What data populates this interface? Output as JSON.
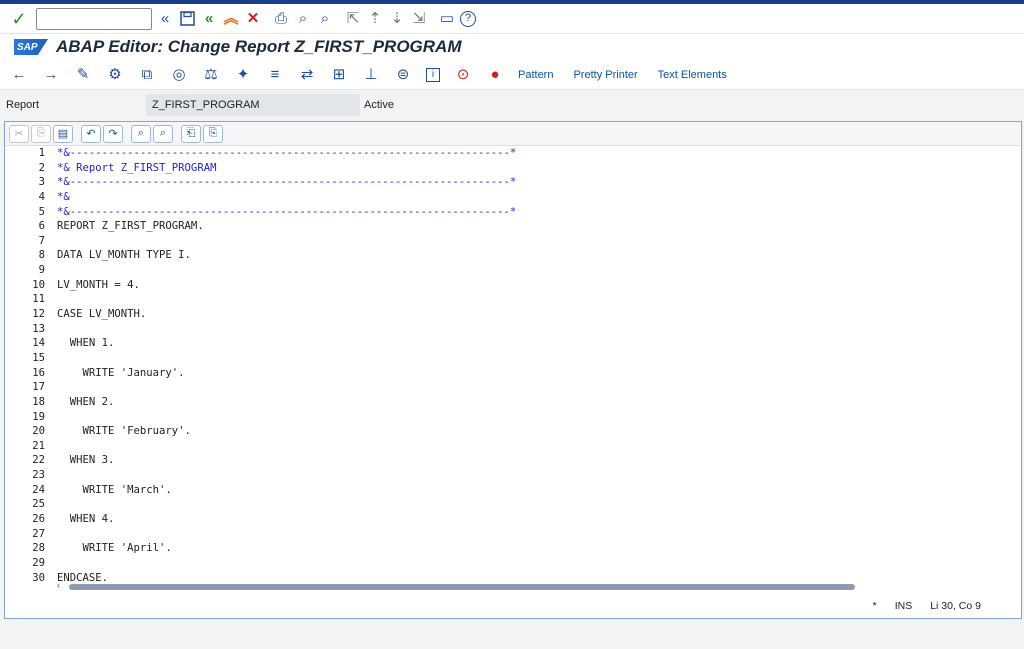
{
  "window": {
    "title": "ABAP Editor: Change Report Z_FIRST_PROGRAM",
    "logo": "SAP"
  },
  "system_toolbar": {
    "icons": [
      "enter-check-icon",
      "back-double-icon",
      "save-icon",
      "back-green-icon",
      "exit-icon",
      "cancel-icon",
      "print-icon",
      "find-icon",
      "find-next-icon",
      "first-page-icon",
      "prev-page-icon",
      "next-page-icon",
      "last-page-icon",
      "new-session-icon",
      "help-icon"
    ]
  },
  "app_toolbar": {
    "pattern_label": "Pattern",
    "pretty_printer_label": "Pretty Printer",
    "text_elements_label": "Text Elements"
  },
  "header": {
    "report_label": "Report",
    "report_value": "Z_FIRST_PROGRAM",
    "status": "Active"
  },
  "editor": {
    "lines": [
      {
        "n": "1",
        "text": "*&---------------------------------------------------------------------*",
        "type": "comment"
      },
      {
        "n": "2",
        "text": "*& Report Z_FIRST_PROGRAM",
        "type": "comment"
      },
      {
        "n": "3",
        "text": "*&---------------------------------------------------------------------*",
        "type": "comment"
      },
      {
        "n": "4",
        "text": "*&",
        "type": "comment"
      },
      {
        "n": "5",
        "text": "*&---------------------------------------------------------------------*",
        "type": "comment"
      },
      {
        "n": "6",
        "text": "REPORT Z_FIRST_PROGRAM.",
        "type": "normal"
      },
      {
        "n": "7",
        "text": "",
        "type": "normal"
      },
      {
        "n": "8",
        "text": "DATA LV_MONTH TYPE I.",
        "type": "normal"
      },
      {
        "n": "9",
        "text": "",
        "type": "normal"
      },
      {
        "n": "10",
        "text": "LV_MONTH = 4.",
        "type": "normal"
      },
      {
        "n": "11",
        "text": "",
        "type": "normal"
      },
      {
        "n": "12",
        "text": "CASE LV_MONTH.",
        "type": "normal"
      },
      {
        "n": "13",
        "text": "",
        "type": "normal"
      },
      {
        "n": "14",
        "text": "  WHEN 1.",
        "type": "normal"
      },
      {
        "n": "15",
        "text": "",
        "type": "normal"
      },
      {
        "n": "16",
        "text": "    WRITE 'January'.",
        "type": "normal"
      },
      {
        "n": "17",
        "text": "",
        "type": "normal"
      },
      {
        "n": "18",
        "text": "  WHEN 2.",
        "type": "normal"
      },
      {
        "n": "19",
        "text": "",
        "type": "normal"
      },
      {
        "n": "20",
        "text": "    WRITE 'February'.",
        "type": "normal"
      },
      {
        "n": "21",
        "text": "",
        "type": "normal"
      },
      {
        "n": "22",
        "text": "  WHEN 3.",
        "type": "normal"
      },
      {
        "n": "23",
        "text": "",
        "type": "normal"
      },
      {
        "n": "24",
        "text": "    WRITE 'March'.",
        "type": "normal"
      },
      {
        "n": "25",
        "text": "",
        "type": "normal"
      },
      {
        "n": "26",
        "text": "  WHEN 4.",
        "type": "normal"
      },
      {
        "n": "27",
        "text": "",
        "type": "normal"
      },
      {
        "n": "28",
        "text": "    WRITE 'April'.",
        "type": "normal"
      },
      {
        "n": "29",
        "text": "",
        "type": "normal"
      },
      {
        "n": "30",
        "text": "ENDCASE.",
        "type": "normal"
      }
    ]
  },
  "status_bar": {
    "modified": "*",
    "mode": "INS",
    "position": "Li 30, Co 9"
  },
  "colors": {
    "comment": "#2222cc",
    "brand": "#1a3d8a",
    "link": "#0a53a6"
  }
}
